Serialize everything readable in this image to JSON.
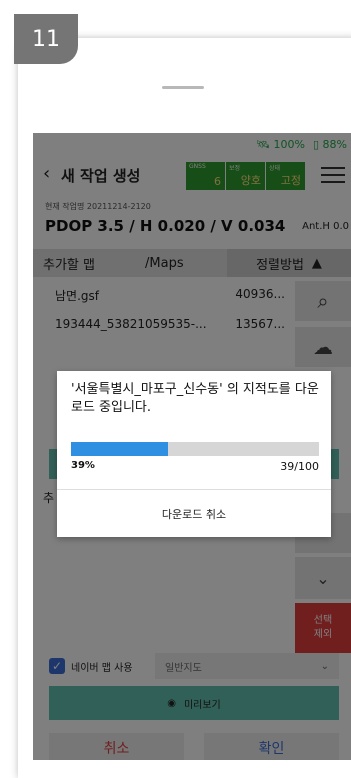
{
  "step": "11",
  "status": {
    "gps": "100%",
    "battery": "88%"
  },
  "header": {
    "back_icon": "‹",
    "title": "새 작업 생성",
    "gnss_label": "GNSS",
    "gnss_value": "6",
    "state_label": "보정",
    "state_value": "양호",
    "mode_label": "상태",
    "mode_value": "고정"
  },
  "job": {
    "name_line": "현재 작업명 20211214-2120"
  },
  "precision": {
    "pdop_line": "PDOP 3.5 / H 0.020 / V 0.034",
    "anth": "Ant.H 0.0"
  },
  "maps_header": {
    "add_map": "추가할 맵",
    "path": "/Maps",
    "sort": "정렬방법",
    "sort_icon": "▲"
  },
  "files": [
    {
      "name": "남면.gsf",
      "size": "40936..."
    },
    {
      "name": "193444_53821059535-...",
      "size": "13567..."
    }
  ],
  "partial_label": "추",
  "select_remove": {
    "line1": "선택",
    "line2": "제외"
  },
  "naver": {
    "label": "네이버 맵 사용",
    "select_value": "일반지도"
  },
  "preview_label": "미리보기",
  "buttons": {
    "cancel": "취소",
    "ok": "확인"
  },
  "dialog": {
    "message": "'서울특별시_마포구_신수동' 의 지적도를 다운로드 중입니다.",
    "progress_percent": "39%",
    "progress_fraction": 0.39,
    "count": "39/100",
    "cancel": "다운로드 취소"
  },
  "colors": {
    "accent_green": "#63c0b0",
    "progress_blue": "#2f8fe0",
    "danger_red": "#e23d3d",
    "gnss_green": "#2e9a2f"
  }
}
